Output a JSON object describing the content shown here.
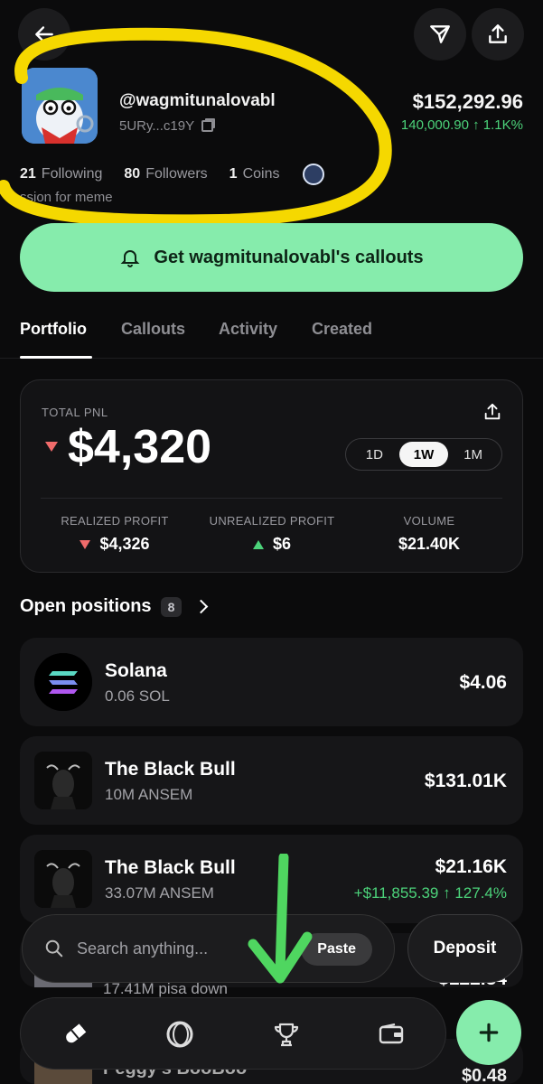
{
  "profile": {
    "handle": "@wagmitunalovabl",
    "address": "5URy...c19Y",
    "balance": "$152,292.96",
    "balance_change": "140,000.90 ↑ 1.1K%",
    "following_count": "21",
    "following_label": "Following",
    "followers_count": "80",
    "followers_label": "Followers",
    "coins_count": "1",
    "coins_label": "Coins",
    "bio": "ssion for meme"
  },
  "callout_button": "Get wagmitunalovabl's callouts",
  "tabs": [
    "Portfolio",
    "Callouts",
    "Activity",
    "Created"
  ],
  "active_tab": "Portfolio",
  "pnl": {
    "label": "TOTAL PNL",
    "value": "$4,320",
    "ranges": [
      "1D",
      "1W",
      "1M"
    ],
    "active_range": "1W",
    "realized_label": "REALIZED PROFIT",
    "realized_value": "$4,326",
    "unrealized_label": "UNREALIZED PROFIT",
    "unrealized_value": "$6",
    "volume_label": "VOLUME",
    "volume_value": "$21.40K"
  },
  "open_positions": {
    "title": "Open positions",
    "count": "8",
    "items": [
      {
        "name": "Solana",
        "amount": "0.06 SOL",
        "value": "$4.06",
        "change": ""
      },
      {
        "name": "The Black Bull",
        "amount": "10M ANSEM",
        "value": "$131.01K",
        "change": ""
      },
      {
        "name": "The Black Bull",
        "amount": "33.07M ANSEM",
        "value": "$21.16K",
        "change": "+$11,855.39 ↑ 127.4%"
      }
    ],
    "partial_amount": "17.41M pisa down",
    "partial_value": "$122.34",
    "partial_bottom_name": "Peggy's BooBoo",
    "partial_bottom_value": "$0.48"
  },
  "search": {
    "placeholder": "Search anything...",
    "paste_label": "Paste"
  },
  "deposit_label": "Deposit",
  "colors": {
    "accent_green": "#86ecac",
    "positive": "#4cd37a",
    "negative": "#f06b6b",
    "highlight_yellow": "#f5d800",
    "annotation_green": "#4fd660"
  }
}
